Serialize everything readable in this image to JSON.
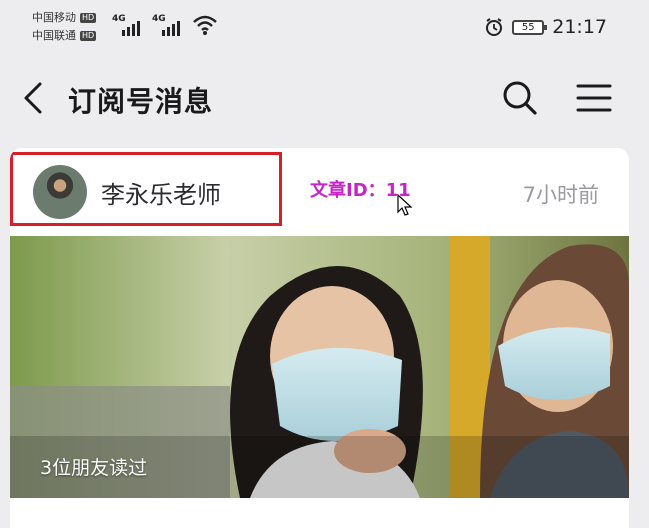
{
  "status_bar": {
    "carrier1": "中国移动",
    "carrier2": "中国联通",
    "hd_badge": "HD",
    "network1": "4G",
    "network2": "4G",
    "battery": "55",
    "time": "21:17"
  },
  "header": {
    "title": "订阅号消息",
    "back_icon": "back-chevron-icon",
    "search_icon": "search-icon",
    "menu_icon": "menu-icon"
  },
  "card": {
    "author_name": "李永乐老师",
    "article_id_label": "文章ID：",
    "article_id": "11",
    "time_ago": "7小时前",
    "readers": "3位朋友读过"
  },
  "colors": {
    "highlight_border": "#d61f26",
    "article_id": "#c724c7",
    "background": "#ededf0"
  }
}
